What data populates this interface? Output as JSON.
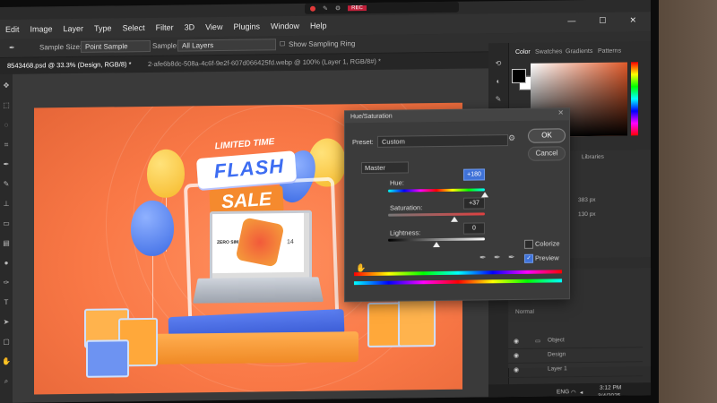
{
  "capture_bar": {
    "label": "REC"
  },
  "window_controls": {
    "minimize": "—",
    "maximize": "☐",
    "close": "✕"
  },
  "menu": [
    "Edit",
    "Image",
    "Layer",
    "Type",
    "Select",
    "Filter",
    "3D",
    "View",
    "Plugins",
    "Window",
    "Help"
  ],
  "options_bar": {
    "sample_size_label": "Sample Size:",
    "sample_size_value": "Point Sample",
    "sample_label": "Sample:",
    "sample_value": "All Layers",
    "show_ring_label": "Show Sampling Ring"
  },
  "tabs": {
    "active": "8543468.psd @ 33.3% (Design, RGB/8) *",
    "inactive": "2-afe6b8dc-508a-4c6f-9e2f-607d066425fd.webp @ 100% (Layer 1, RGB/8#) *"
  },
  "color_panel": {
    "tabs": [
      "Color",
      "Swatches",
      "Gradients",
      "Patterns"
    ],
    "fg_color": "#000000",
    "bg_color": "#ffffff"
  },
  "properties_panel": {
    "tab": "Libraries",
    "w_value": "383 px",
    "h_value": "130 px"
  },
  "layers_panel": {
    "normal_label": "Normal",
    "layers": [
      "Object",
      "Design",
      "Layer 1"
    ]
  },
  "taskbar": {
    "lang": "ENG",
    "time": "3:12 PM",
    "date": "3/4/2025"
  },
  "artwork": {
    "limited_time": "LIMITED TIME",
    "flash": "FLASH",
    "sale": "SALE",
    "laptop_brand": "ZERO SIM",
    "laptop_number": "14"
  },
  "dialog": {
    "title": "Hue/Saturation",
    "preset_label": "Preset:",
    "preset_value": "Custom",
    "ok_label": "OK",
    "cancel_label": "Cancel",
    "channel_value": "Master",
    "hue_label": "Hue:",
    "hue_value": "+180",
    "saturation_label": "Saturation:",
    "saturation_value": "+37",
    "lightness_label": "Lightness:",
    "lightness_value": "0",
    "colorize_label": "Colorize",
    "preview_label": "Preview",
    "hue_slider_fraction": 1.0,
    "saturation_slider_fraction": 0.685,
    "lightness_slider_fraction": 0.5,
    "colorize_checked": false,
    "preview_checked": true
  }
}
